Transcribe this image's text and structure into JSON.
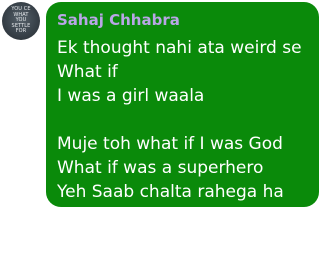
{
  "message": {
    "avatar": {
      "text_lines": [
        "YOU CE",
        "WHAT",
        "YOU",
        "SETTLE",
        "FOR"
      ]
    },
    "sender_name": "Sahaj Chhabra",
    "lines": [
      "Ek thought nahi ata weird se",
      "What if",
      "I was a girl waala",
      "",
      "Muje toh what if I was God",
      "What if was a superhero",
      "Yeh Saab chalta rahega ha"
    ],
    "colors": {
      "bubble": "#0a8a0a",
      "sender_name": "#b9a6e6",
      "text": "#ffffff"
    }
  }
}
